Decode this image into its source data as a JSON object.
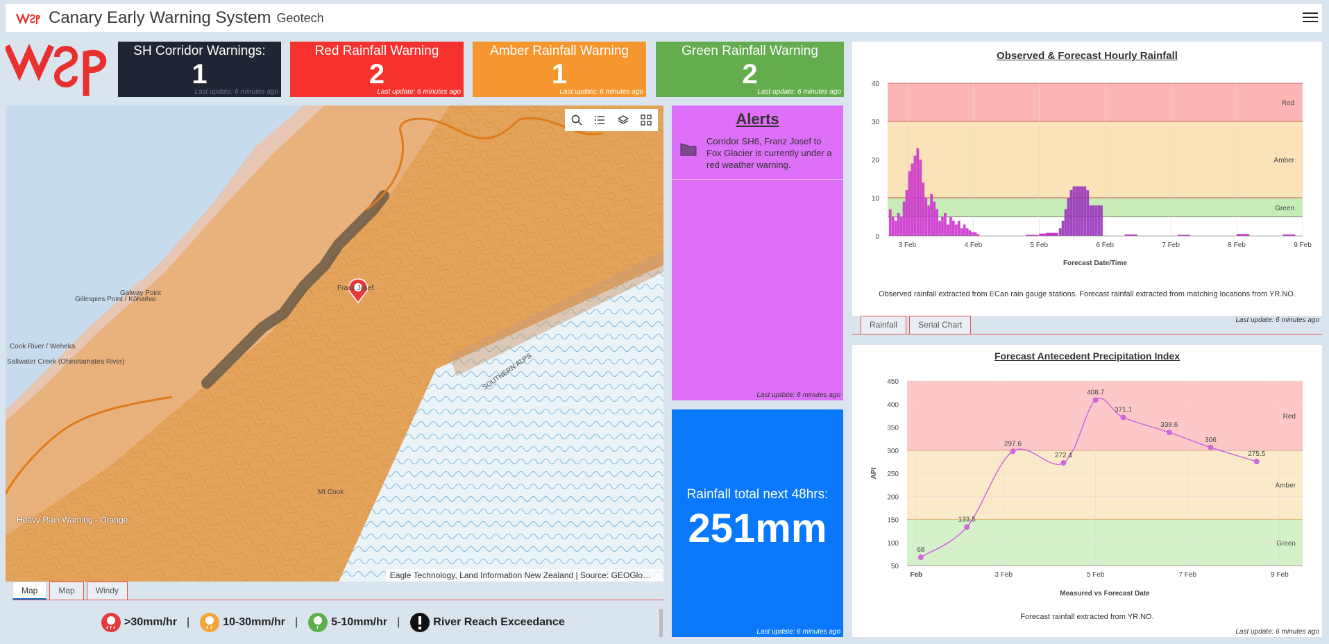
{
  "header": {
    "logo": "wsp-logo",
    "title": "Canary Early Warning System",
    "subtitle": "Geotech",
    "menu_icon": "hamburger-menu-icon"
  },
  "cards": {
    "corridor": {
      "title": "SH Corridor Warnings:",
      "count": "1",
      "updated": "Last update: 6 minutes ago"
    },
    "red": {
      "title": "Red Rainfall Warning",
      "count": "2",
      "updated": "Last update: 6 minutes ago"
    },
    "amber": {
      "title": "Amber Rainfall Warning",
      "count": "1",
      "updated": "Last update: 6 minutes ago"
    },
    "green": {
      "title": "Green Rainfall Warning",
      "count": "2",
      "updated": "Last update: 6 minutes ago"
    }
  },
  "map": {
    "tools": [
      "search-icon",
      "list-icon",
      "layers-icon",
      "qr-grid-icon"
    ],
    "layer_label": "Heavy Rain Warning - Orange",
    "attribution": "Eagle Technology, Land Information New Zealand | Source: GEOGlo…",
    "place_labels": [
      "Cook River / Weheka",
      "Gillespies Point / Kōhaihai",
      "Galway Point",
      "Saltwater Creek (Ohinetamatea River)",
      "SOUTHERN ALPS",
      "Franz Josef",
      "Mt Cook"
    ],
    "tabs": [
      "Map",
      "Map",
      "Windy"
    ],
    "active_tab": 0
  },
  "legend": [
    {
      "icon": "heavy-rain-red-icon",
      "label": ">30mm/hr"
    },
    {
      "icon": "rain-amber-icon",
      "label": "10-30mm/hr"
    },
    {
      "icon": "rain-green-icon",
      "label": "5-10mm/hr"
    },
    {
      "icon": "exclamation-icon",
      "label": "River Reach Exceedance"
    }
  ],
  "alerts": {
    "title": "Alerts",
    "items": [
      {
        "text": "Corridor SH6, Franz Josef to Fox Glacier is currently under a red weather warning."
      }
    ],
    "updated": "Last update: 6 minutes ago"
  },
  "rain_total": {
    "label": "Rainfall total next 48hrs:",
    "value": "251mm",
    "updated": "Last update: 6 minutes ago"
  },
  "rainfall_panel": {
    "note": "Observed rainfall extracted from ECan rain gauge stations. Forecast rainfall extracted from matching locations from YR.NO.",
    "updated": "Last update: 6 minutes ago",
    "tabs": [
      "Rainfall",
      "Serial Chart"
    ],
    "active_tab": 0
  },
  "api_panel": {
    "note": "Forecast rainfall extracted from YR.NO.",
    "updated": "Last update: 6 minutes ago"
  },
  "colors": {
    "red_zone": "#fdb6b6",
    "amber_zone": "#fae3b8",
    "green_zone": "#c7ecb8",
    "bar_observed": "#cc33cc",
    "bar_forecast": "#9933bb",
    "api_line": "#cc66dd",
    "card_dark": "#1f2532",
    "card_red": "#f5322d",
    "card_amber": "#f5962f",
    "card_green": "#63ad4e",
    "alerts_bg": "#de6ff8",
    "total_bg": "#0a78fb"
  },
  "chart_data": [
    {
      "type": "bar",
      "title": "Observed & Forecast Hourly Rainfall",
      "xlabel": "Forecast Date/Time",
      "ylabel": "",
      "ylim": [
        0,
        40
      ],
      "yticks": [
        0,
        10,
        20,
        30,
        40
      ],
      "x_ticks": [
        "3 Feb",
        "4 Feb",
        "5 Feb",
        "6 Feb",
        "7 Feb",
        "8 Feb",
        "9 Feb"
      ],
      "x_range_days": [
        2.7,
        9.0
      ],
      "thresholds": [
        {
          "name": "Red",
          "from": 30,
          "to": 40
        },
        {
          "name": "Amber",
          "from": 10,
          "to": 30
        },
        {
          "name": "Green",
          "from": 5,
          "to": 10
        }
      ],
      "series": [
        {
          "x_start_day": 2.72,
          "bar_width_day": 0.0417,
          "values": [
            7,
            5,
            4,
            6,
            5,
            9,
            12,
            17,
            19,
            21,
            23,
            20,
            14,
            10,
            8,
            11,
            9,
            7,
            4,
            5,
            6,
            3,
            5,
            4,
            3,
            4,
            2,
            3,
            2,
            1.5,
            1,
            1,
            0.5
          ]
        },
        {
          "x_start_day": 5.3,
          "bar_width_day": 0.0417,
          "values": [
            2,
            4,
            7,
            10,
            12,
            13,
            13,
            13,
            13,
            13,
            12,
            8,
            8,
            8,
            8,
            8
          ]
        }
      ]
    },
    {
      "type": "line",
      "title": "Forecast Antecedent Precipitation Index",
      "xlabel": "Measured vs Forecast Date",
      "ylabel": "API",
      "ylim": [
        50,
        450
      ],
      "yticks": [
        50,
        100,
        150,
        200,
        250,
        300,
        350,
        400,
        450
      ],
      "x_ticks": [
        "Feb",
        "3 Feb",
        "5 Feb",
        "7 Feb",
        "9 Feb"
      ],
      "thresholds": [
        {
          "name": "Red",
          "from": 300,
          "to": 450
        },
        {
          "name": "Amber",
          "from": 150,
          "to": 300
        },
        {
          "name": "Green",
          "from": 50,
          "to": 150
        }
      ],
      "x_days": [
        1.2,
        2.2,
        3.2,
        4.3,
        5.0,
        5.6,
        6.6,
        7.5,
        8.5
      ],
      "values": [
        68,
        133.5,
        297.6,
        272.4,
        408.7,
        371.1,
        338.6,
        306,
        275.5
      ]
    }
  ]
}
